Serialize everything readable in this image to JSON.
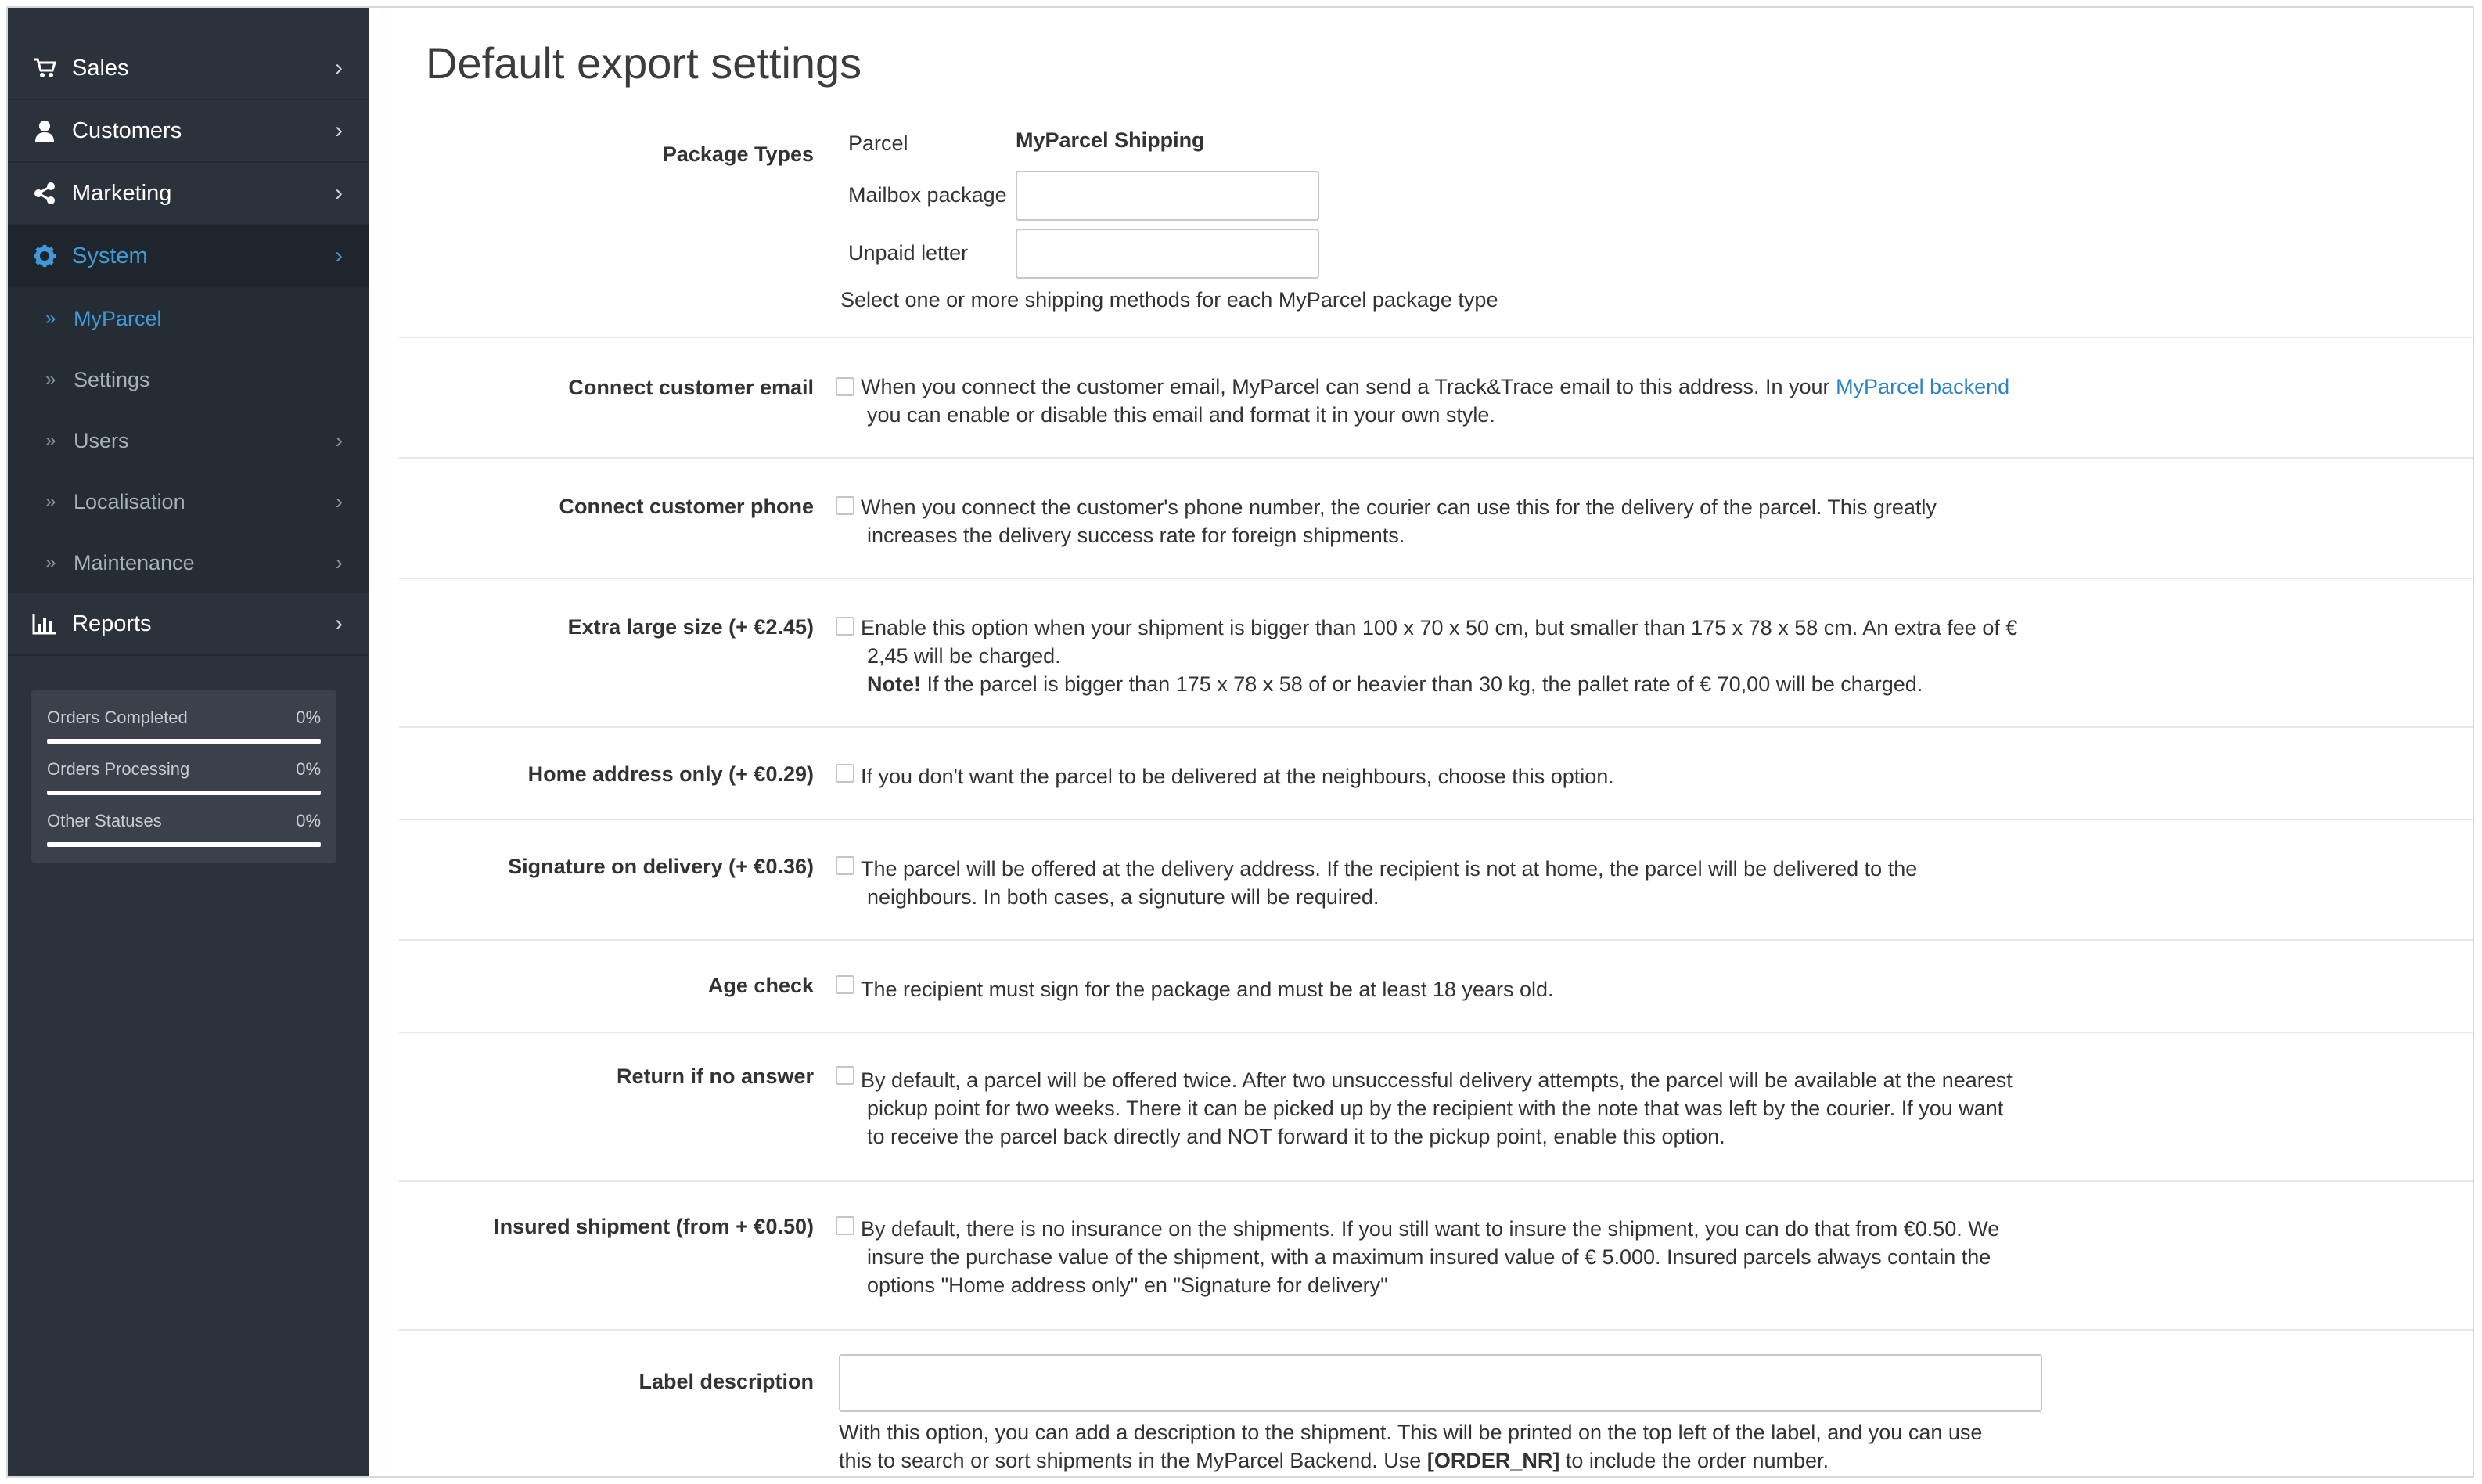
{
  "sidebar": {
    "items": [
      {
        "label": "Sales"
      },
      {
        "label": "Customers"
      },
      {
        "label": "Marketing"
      },
      {
        "label": "System"
      },
      {
        "label": "Reports"
      }
    ],
    "sub_items": [
      {
        "label": "MyParcel"
      },
      {
        "label": "Settings"
      },
      {
        "label": "Users"
      },
      {
        "label": "Localisation"
      },
      {
        "label": "Maintenance"
      }
    ],
    "stats": [
      {
        "name": "Orders Completed",
        "percent": "0%"
      },
      {
        "name": "Orders Processing",
        "percent": "0%"
      },
      {
        "name": "Other Statuses",
        "percent": "0%"
      }
    ]
  },
  "main": {
    "title": "Default export settings",
    "package_types": {
      "label": "Package Types",
      "rows": [
        {
          "type": "Parcel",
          "value": "MyParcel Shipping"
        },
        {
          "type": "Mailbox package",
          "value": ""
        },
        {
          "type": "Unpaid letter",
          "value": ""
        }
      ],
      "help": "Select one or more shipping methods for each MyParcel package type"
    },
    "options": [
      {
        "label": "Connect customer email",
        "line1": "When you connect the customer email, MyParcel can send a Track&Trace email to this address. In your ",
        "link": "MyParcel backend",
        "line2": "you can enable or disable this email and format it in your own style."
      },
      {
        "label": "Connect customer phone",
        "line1": "When you connect the customer's phone number, the courier can use this for the delivery of the parcel. This greatly",
        "line2": "increases the delivery success rate for foreign shipments."
      },
      {
        "label": "Extra large size (+ €2.45)",
        "line1": "Enable this option when your shipment is bigger than 100 x 70 x 50 cm, but smaller than 175 x 78 x 58 cm. An extra fee of €",
        "line2": "2,45 will be charged.",
        "note_label": "Note!",
        "note_text": " If the parcel is bigger than 175 x 78 x 58 of or heavier than 30 kg, the pallet rate of € 70,00 will be charged."
      },
      {
        "label": "Home address only (+ €0.29)",
        "line1": "If you don't want the parcel to be delivered at the neighbours, choose this option."
      },
      {
        "label": "Signature on delivery (+ €0.36)",
        "line1": "The parcel will be offered at the delivery address. If the recipient is not at home, the parcel will be delivered to the",
        "line2": "neighbours. In both cases, a signuture will be required."
      },
      {
        "label": "Age check",
        "line1": "The recipient must sign for the package and must be at least 18 years old."
      },
      {
        "label": "Return if no answer",
        "line1": "By default, a parcel will be offered twice. After two unsuccessful delivery attempts, the parcel will be available at the nearest",
        "line2": "pickup point for two weeks. There it can be picked up by the recipient with the note that was left by the courier. If you want",
        "line3": "to receive the parcel back directly and NOT forward it to the pickup point, enable this option."
      },
      {
        "label": "Insured shipment (from + €0.50)",
        "line1": "By default, there is no insurance on the shipments. If you still want to insure the shipment, you can do that from €0.50. We",
        "line2": "insure the purchase value of the shipment, with a maximum insured value of € 5.000. Insured parcels always contain the",
        "line3": "options \"Home address only\" en \"Signature for delivery\""
      }
    ],
    "label_description": {
      "label": "Label description",
      "value": "",
      "help_line1": "With this option, you can add a description to the shipment. This will be printed on the top left of the label, and you can use",
      "help_line2_a": "this to search or sort shipments in the MyParcel Backend. Use ",
      "help_line2_code": "[ORDER_NR]",
      "help_line2_b": " to include the order number."
    }
  }
}
